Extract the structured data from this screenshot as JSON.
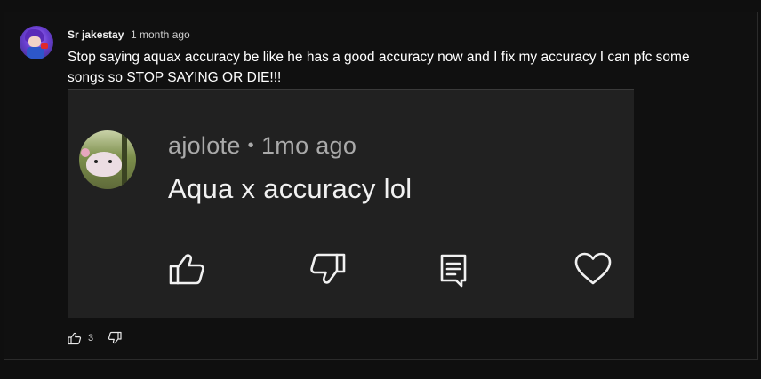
{
  "comment": {
    "author": "Sr jakestay",
    "timestamp": "1 month ago",
    "text": "Stop saying aquax accuracy be like he has a good accuracy now and I fix my accuracy I can pfc some songs so STOP SAYING OR DIE!!!",
    "like_count": "3"
  },
  "embedded_comment": {
    "author": "ajolote",
    "separator": "•",
    "timestamp": "1mo ago",
    "text": "Aqua x accuracy lol"
  },
  "icons": {
    "like": "thumb-up-icon",
    "dislike": "thumb-down-icon",
    "reply": "reply-comment-icon",
    "heart": "heart-icon"
  },
  "colors": {
    "background": "#0f0f0f",
    "embed_background": "#212121",
    "primary_text": "#ffffff",
    "secondary_text": "#aaaaaa"
  }
}
